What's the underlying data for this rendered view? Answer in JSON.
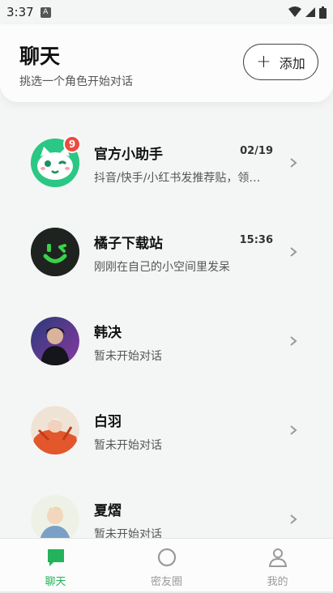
{
  "status_bar": {
    "time": "3:37"
  },
  "header": {
    "title": "聊天",
    "subtitle": "挑选一个角色开始对话",
    "add_button": "添加"
  },
  "colors": {
    "accent": "#22b35c",
    "badge": "#ef4a3f"
  },
  "chats": [
    {
      "name": "官方小助手",
      "message": "抖音/快手/小红书发推荐贴，领…",
      "date": "02/19",
      "badge": "9",
      "avatar": "cat-mascot-avatar"
    },
    {
      "name": "橘子下载站",
      "message": "刚刚在自己的小空间里发呆",
      "date": "15:36",
      "badge": "",
      "avatar": "smiley-logo-avatar"
    },
    {
      "name": "韩决",
      "message": "暂未开始对话",
      "date": "",
      "badge": "",
      "avatar": "character-avatar"
    },
    {
      "name": "白羽",
      "message": "暂未开始对话",
      "date": "",
      "badge": "",
      "avatar": "character-avatar"
    },
    {
      "name": "夏熠",
      "message": "暂未开始对话",
      "date": "",
      "badge": "",
      "avatar": "character-avatar"
    }
  ],
  "tabs": [
    {
      "label": "聊天",
      "icon": "chat-bubble-icon",
      "active": true
    },
    {
      "label": "密友圈",
      "icon": "circle-icon",
      "active": false
    },
    {
      "label": "我的",
      "icon": "person-icon",
      "active": false
    }
  ]
}
